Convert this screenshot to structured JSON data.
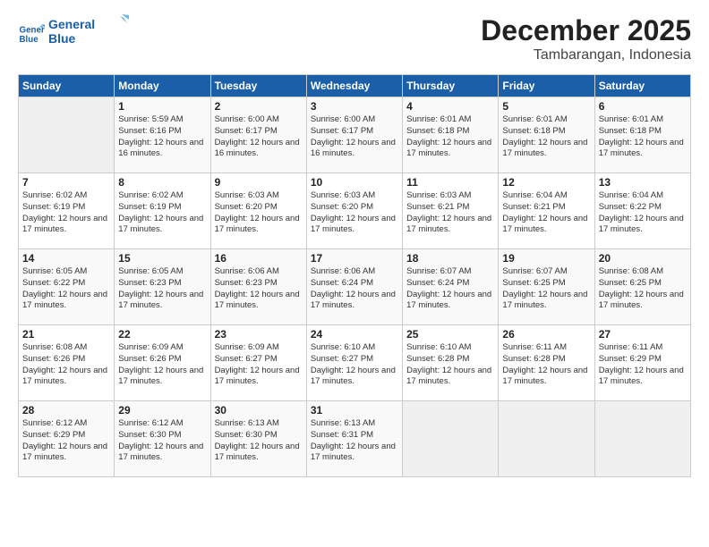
{
  "logo": {
    "line1": "General",
    "line2": "Blue"
  },
  "title": "December 2025",
  "subtitle": "Tambarangan, Indonesia",
  "header_days": [
    "Sunday",
    "Monday",
    "Tuesday",
    "Wednesday",
    "Thursday",
    "Friday",
    "Saturday"
  ],
  "weeks": [
    [
      {
        "day": "",
        "sunrise": "",
        "sunset": "",
        "daylight": ""
      },
      {
        "day": "1",
        "sunrise": "Sunrise: 5:59 AM",
        "sunset": "Sunset: 6:16 PM",
        "daylight": "Daylight: 12 hours and 16 minutes."
      },
      {
        "day": "2",
        "sunrise": "Sunrise: 6:00 AM",
        "sunset": "Sunset: 6:17 PM",
        "daylight": "Daylight: 12 hours and 16 minutes."
      },
      {
        "day": "3",
        "sunrise": "Sunrise: 6:00 AM",
        "sunset": "Sunset: 6:17 PM",
        "daylight": "Daylight: 12 hours and 16 minutes."
      },
      {
        "day": "4",
        "sunrise": "Sunrise: 6:01 AM",
        "sunset": "Sunset: 6:18 PM",
        "daylight": "Daylight: 12 hours and 17 minutes."
      },
      {
        "day": "5",
        "sunrise": "Sunrise: 6:01 AM",
        "sunset": "Sunset: 6:18 PM",
        "daylight": "Daylight: 12 hours and 17 minutes."
      },
      {
        "day": "6",
        "sunrise": "Sunrise: 6:01 AM",
        "sunset": "Sunset: 6:18 PM",
        "daylight": "Daylight: 12 hours and 17 minutes."
      }
    ],
    [
      {
        "day": "7",
        "sunrise": "Sunrise: 6:02 AM",
        "sunset": "Sunset: 6:19 PM",
        "daylight": "Daylight: 12 hours and 17 minutes."
      },
      {
        "day": "8",
        "sunrise": "Sunrise: 6:02 AM",
        "sunset": "Sunset: 6:19 PM",
        "daylight": "Daylight: 12 hours and 17 minutes."
      },
      {
        "day": "9",
        "sunrise": "Sunrise: 6:03 AM",
        "sunset": "Sunset: 6:20 PM",
        "daylight": "Daylight: 12 hours and 17 minutes."
      },
      {
        "day": "10",
        "sunrise": "Sunrise: 6:03 AM",
        "sunset": "Sunset: 6:20 PM",
        "daylight": "Daylight: 12 hours and 17 minutes."
      },
      {
        "day": "11",
        "sunrise": "Sunrise: 6:03 AM",
        "sunset": "Sunset: 6:21 PM",
        "daylight": "Daylight: 12 hours and 17 minutes."
      },
      {
        "day": "12",
        "sunrise": "Sunrise: 6:04 AM",
        "sunset": "Sunset: 6:21 PM",
        "daylight": "Daylight: 12 hours and 17 minutes."
      },
      {
        "day": "13",
        "sunrise": "Sunrise: 6:04 AM",
        "sunset": "Sunset: 6:22 PM",
        "daylight": "Daylight: 12 hours and 17 minutes."
      }
    ],
    [
      {
        "day": "14",
        "sunrise": "Sunrise: 6:05 AM",
        "sunset": "Sunset: 6:22 PM",
        "daylight": "Daylight: 12 hours and 17 minutes."
      },
      {
        "day": "15",
        "sunrise": "Sunrise: 6:05 AM",
        "sunset": "Sunset: 6:23 PM",
        "daylight": "Daylight: 12 hours and 17 minutes."
      },
      {
        "day": "16",
        "sunrise": "Sunrise: 6:06 AM",
        "sunset": "Sunset: 6:23 PM",
        "daylight": "Daylight: 12 hours and 17 minutes."
      },
      {
        "day": "17",
        "sunrise": "Sunrise: 6:06 AM",
        "sunset": "Sunset: 6:24 PM",
        "daylight": "Daylight: 12 hours and 17 minutes."
      },
      {
        "day": "18",
        "sunrise": "Sunrise: 6:07 AM",
        "sunset": "Sunset: 6:24 PM",
        "daylight": "Daylight: 12 hours and 17 minutes."
      },
      {
        "day": "19",
        "sunrise": "Sunrise: 6:07 AM",
        "sunset": "Sunset: 6:25 PM",
        "daylight": "Daylight: 12 hours and 17 minutes."
      },
      {
        "day": "20",
        "sunrise": "Sunrise: 6:08 AM",
        "sunset": "Sunset: 6:25 PM",
        "daylight": "Daylight: 12 hours and 17 minutes."
      }
    ],
    [
      {
        "day": "21",
        "sunrise": "Sunrise: 6:08 AM",
        "sunset": "Sunset: 6:26 PM",
        "daylight": "Daylight: 12 hours and 17 minutes."
      },
      {
        "day": "22",
        "sunrise": "Sunrise: 6:09 AM",
        "sunset": "Sunset: 6:26 PM",
        "daylight": "Daylight: 12 hours and 17 minutes."
      },
      {
        "day": "23",
        "sunrise": "Sunrise: 6:09 AM",
        "sunset": "Sunset: 6:27 PM",
        "daylight": "Daylight: 12 hours and 17 minutes."
      },
      {
        "day": "24",
        "sunrise": "Sunrise: 6:10 AM",
        "sunset": "Sunset: 6:27 PM",
        "daylight": "Daylight: 12 hours and 17 minutes."
      },
      {
        "day": "25",
        "sunrise": "Sunrise: 6:10 AM",
        "sunset": "Sunset: 6:28 PM",
        "daylight": "Daylight: 12 hours and 17 minutes."
      },
      {
        "day": "26",
        "sunrise": "Sunrise: 6:11 AM",
        "sunset": "Sunset: 6:28 PM",
        "daylight": "Daylight: 12 hours and 17 minutes."
      },
      {
        "day": "27",
        "sunrise": "Sunrise: 6:11 AM",
        "sunset": "Sunset: 6:29 PM",
        "daylight": "Daylight: 12 hours and 17 minutes."
      }
    ],
    [
      {
        "day": "28",
        "sunrise": "Sunrise: 6:12 AM",
        "sunset": "Sunset: 6:29 PM",
        "daylight": "Daylight: 12 hours and 17 minutes."
      },
      {
        "day": "29",
        "sunrise": "Sunrise: 6:12 AM",
        "sunset": "Sunset: 6:30 PM",
        "daylight": "Daylight: 12 hours and 17 minutes."
      },
      {
        "day": "30",
        "sunrise": "Sunrise: 6:13 AM",
        "sunset": "Sunset: 6:30 PM",
        "daylight": "Daylight: 12 hours and 17 minutes."
      },
      {
        "day": "31",
        "sunrise": "Sunrise: 6:13 AM",
        "sunset": "Sunset: 6:31 PM",
        "daylight": "Daylight: 12 hours and 17 minutes."
      },
      {
        "day": "",
        "sunrise": "",
        "sunset": "",
        "daylight": ""
      },
      {
        "day": "",
        "sunrise": "",
        "sunset": "",
        "daylight": ""
      },
      {
        "day": "",
        "sunrise": "",
        "sunset": "",
        "daylight": ""
      }
    ]
  ]
}
